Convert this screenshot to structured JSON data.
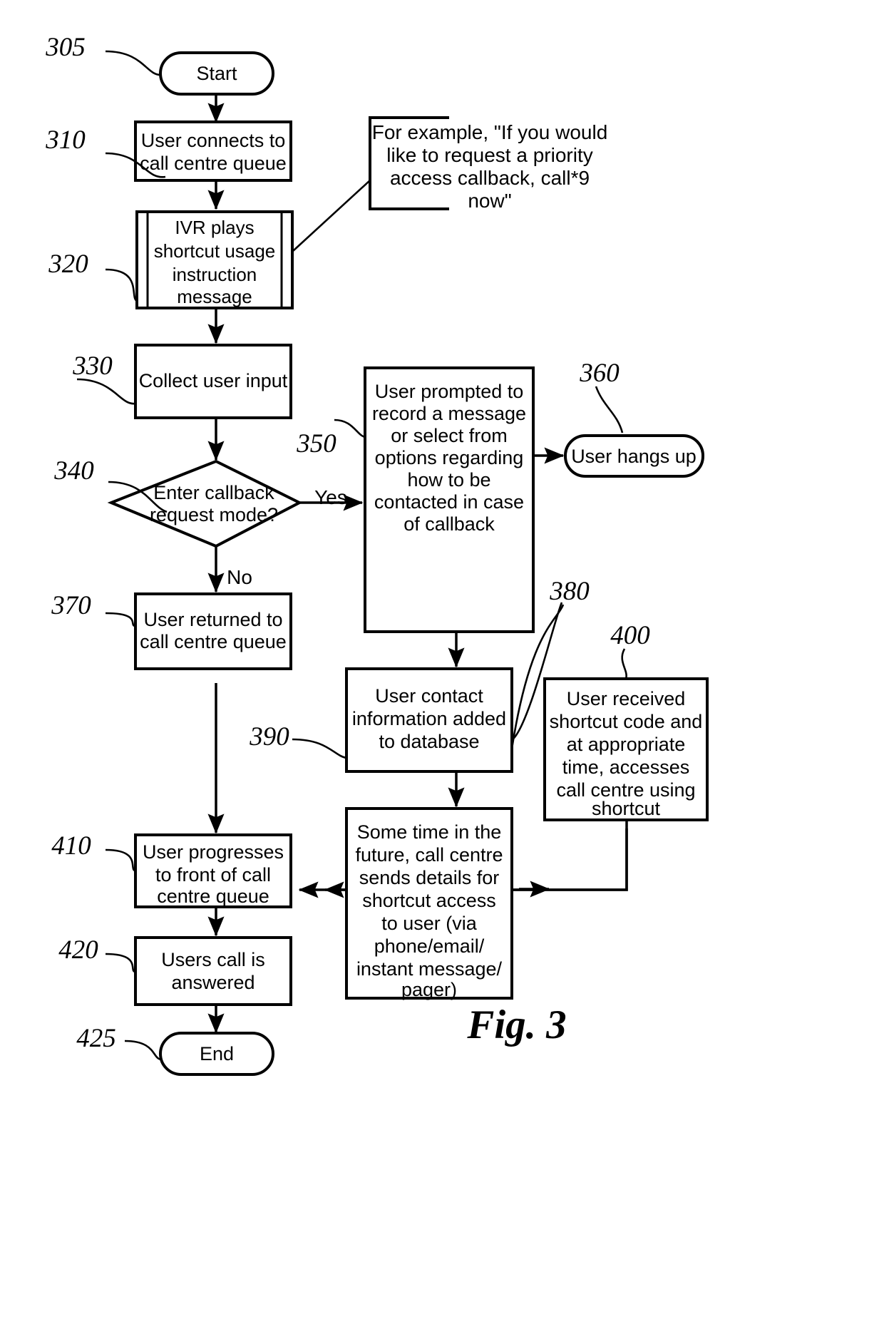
{
  "figure": {
    "label": "Fig. 3",
    "caption_ref": "Fig. 3"
  },
  "edge_labels": {
    "yes": "Yes",
    "no": "No"
  },
  "reference_numerals": {
    "n305": "305",
    "n310": "310",
    "n320": "320",
    "n330": "330",
    "n340": "340",
    "n350": "350",
    "n360": "360",
    "n370": "370",
    "n380": "380",
    "n390": "390",
    "n400": "400",
    "n410": "410",
    "n420": "420",
    "n425": "425"
  },
  "nodes": {
    "start": {
      "ref": "305",
      "shape": "terminator",
      "lines": [
        "Start"
      ]
    },
    "connect_queue": {
      "ref": "310",
      "shape": "process",
      "lines": [
        "User connects to",
        "call centre queue"
      ]
    },
    "ivr_plays": {
      "ref": "320",
      "shape": "predefined-process",
      "lines": [
        "IVR plays",
        "shortcut usage",
        "instruction",
        "message"
      ]
    },
    "collect_input": {
      "ref": "330",
      "shape": "process",
      "lines": [
        "Collect user input"
      ]
    },
    "decision_mode": {
      "ref": "340",
      "shape": "decision",
      "lines": [
        "Enter callback",
        "request mode?"
      ]
    },
    "record_message": {
      "ref": "350",
      "shape": "process",
      "lines": [
        "User prompted to",
        "record a message",
        "or select from",
        "options regarding",
        "how to be",
        "contacted in case",
        "of callback"
      ]
    },
    "hangs_up": {
      "ref": "360",
      "shape": "terminator",
      "lines": [
        "User hangs up"
      ]
    },
    "returned_queue": {
      "ref": "370",
      "shape": "process",
      "lines": [
        "User returned to",
        "call centre queue"
      ]
    },
    "contact_db": {
      "ref": "380",
      "shape": "process",
      "lines": [
        "User contact",
        "information added",
        "to database"
      ]
    },
    "sends_details": {
      "ref": "390",
      "shape": "process",
      "lines": [
        "Some time in the",
        "future, call centre",
        "sends details for",
        "shortcut access",
        "to user (via",
        "phone/email/",
        "instant message/",
        "pager)"
      ]
    },
    "received_code": {
      "ref": "400",
      "shape": "process",
      "lines": [
        "User received",
        "shortcut code and",
        "at appropriate",
        "time, accesses",
        "call centre using",
        "shortcut"
      ]
    },
    "progresses_front": {
      "ref": "410",
      "shape": "process",
      "lines": [
        "User progresses",
        "to front of call",
        "centre queue"
      ]
    },
    "call_answered": {
      "ref": "420",
      "shape": "process",
      "lines": [
        "Users call is",
        "answered"
      ]
    },
    "end": {
      "ref": "425",
      "shape": "terminator",
      "lines": [
        "End"
      ]
    }
  },
  "callout": {
    "ref_target": "320",
    "lines": [
      "For example, \"If you would",
      "like to request a priority",
      "access callback, call*9",
      "now\""
    ]
  }
}
